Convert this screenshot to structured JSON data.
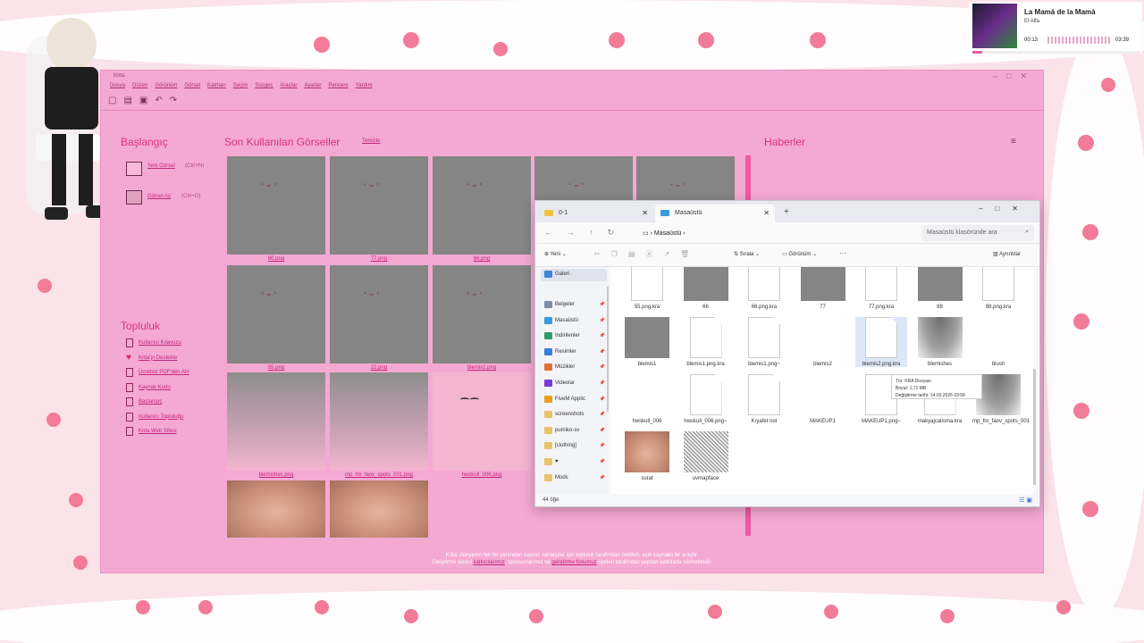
{
  "media": {
    "title": "La Mamá de la Mamá",
    "artist": "El Alfa",
    "elapsed": "00:13",
    "duration": "03:39",
    "progress": 0.06
  },
  "krita": {
    "window_title": "Krita",
    "menu": [
      "Dosya",
      "Düzen",
      "Görünüm",
      "Görsel",
      "Katman",
      "Seçim",
      "Süzgeç",
      "Araçlar",
      "Ayarlar",
      "Pencere",
      "Yardım"
    ],
    "start_heading": "Başlangıç",
    "new_image": "Yeni Görsel",
    "new_image_shortcut": "(Ctrl+N)",
    "open_image": "Görsel Aç",
    "open_image_shortcut": "(Ctrl+O)",
    "recent_heading": "Son Kullanılan Görseller",
    "clear_link": "Temizle",
    "news_heading": "Haberler",
    "community_heading": "Topluluk",
    "community_links": [
      "Kullanıcı Kılavuzu",
      "Krita'yı Destekle",
      "Ücretsiz PDF'den Alır",
      "Kaynak Kodu",
      "Başlangıç",
      "Kullanıcı Topluluğu",
      "Krita Web Sitesi"
    ],
    "recent": [
      {
        "label": "80.png"
      },
      {
        "label": "77.png"
      },
      {
        "label": "66.png"
      },
      {
        "label": ""
      },
      {
        "label": ""
      },
      {
        "label": "55.png"
      },
      {
        "label": "22.png"
      },
      {
        "label": "blemis1.png"
      },
      {
        "label": "blemishes.png"
      },
      {
        "label": "mp_fm_faov_spots_001.png"
      },
      {
        "label": "hwskull_006.png"
      }
    ],
    "footer_line1": "Krita; dünyanın her bir yanından sayısız sanatçılar için topluluk tarafından üretilen, açık kaynaklı bir araçtır.",
    "footer_line2_a": "Geliştirme süreci",
    "footer_link1": "katkıcılarımız",
    "footer_line2_b": "sponsorlarımız ve",
    "footer_link2": "geliştirme fonumuz",
    "footer_line2_c": "üyeleri tarafından yapılan katkılarla sürmektedir."
  },
  "explorer": {
    "tabs": [
      {
        "label": "0-1"
      },
      {
        "label": "Masaüstü"
      }
    ],
    "breadcrumb": "Masaüstü",
    "search_placeholder": "Masaüstü klasöründe ara",
    "cmd": {
      "new": "Yeni",
      "sort": "Sırala",
      "view": "Görünüm",
      "details": "Ayrıntılar"
    },
    "nav": [
      {
        "label": "Galeri",
        "color": "#3a86d8"
      },
      {
        "label": "Belgeler",
        "color": "#7b8fa8"
      },
      {
        "label": "Masaüstü",
        "color": "#3a9ad8"
      },
      {
        "label": "İndirilenler",
        "color": "#2e9b6f"
      },
      {
        "label": "Resimler",
        "color": "#3a7fd8"
      },
      {
        "label": "Müzikler",
        "color": "#e0703a"
      },
      {
        "label": "Videolar",
        "color": "#7a3ad8"
      },
      {
        "label": "FiveM Applic",
        "color": "#e8a01e"
      },
      {
        "label": "screenshots",
        "color": "#e8c46a"
      },
      {
        "label": "pumiko-sv",
        "color": "#e8c46a"
      },
      {
        "label": "[clothing]",
        "color": "#e8c46a"
      },
      {
        "label": "♥",
        "color": "#e8c46a"
      },
      {
        "label": "Mods",
        "color": "#e8c46a"
      }
    ],
    "files": [
      {
        "name": "55.png.kra",
        "kind": "doc"
      },
      {
        "name": "66",
        "kind": "gray"
      },
      {
        "name": "66.png.kra",
        "kind": "doc"
      },
      {
        "name": "77",
        "kind": "gray"
      },
      {
        "name": "77.png.kra",
        "kind": "doc"
      },
      {
        "name": "88",
        "kind": "gray"
      },
      {
        "name": "88.png.kra",
        "kind": "doc"
      },
      {
        "name": "blemis1",
        "kind": "gray"
      },
      {
        "name": "blemis1.png.kra",
        "kind": "doc"
      },
      {
        "name": "blemis1.png~",
        "kind": "doc"
      },
      {
        "name": "blemis2",
        "kind": "white"
      },
      {
        "name": "blemis2.png.kra",
        "kind": "doc"
      },
      {
        "name": "blemishes",
        "kind": "fade"
      },
      {
        "name": "blush",
        "kind": "white"
      },
      {
        "name": "hwskull_006",
        "kind": "white"
      },
      {
        "name": "hwskull_006.png~",
        "kind": "doc"
      },
      {
        "name": "Kıyafet not",
        "kind": "doc"
      },
      {
        "name": "MAKEUP1",
        "kind": "white"
      },
      {
        "name": "MAKEUP1.png~",
        "kind": "doc"
      },
      {
        "name": "makyajcalisma.kra",
        "kind": "doc"
      },
      {
        "name": "mp_fm_faov_spots_001",
        "kind": "fade"
      },
      {
        "name": "surat",
        "kind": "skin"
      },
      {
        "name": "uvmapface",
        "kind": "uv"
      }
    ],
    "tooltip": {
      "type": "Tür: KRA Dosyası",
      "size": "Boyut: 1,71 MB",
      "modified": "Değiştirme tarihi: 14.03.2026 03:58"
    },
    "status": "44 öğe"
  }
}
